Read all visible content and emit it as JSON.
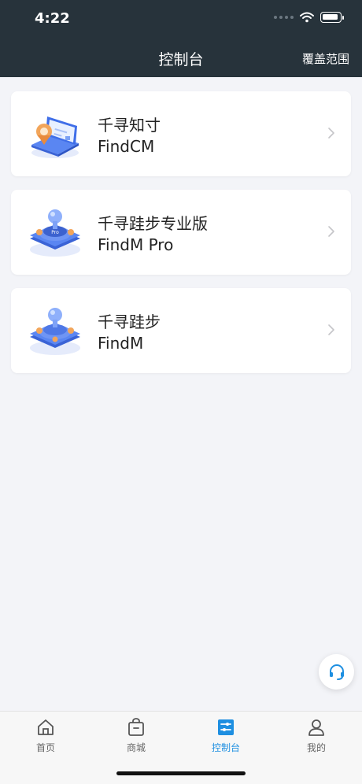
{
  "status_bar": {
    "time": "4:22"
  },
  "nav": {
    "title": "控制台",
    "right_action": "覆盖范围"
  },
  "products": [
    {
      "name_cn": "千寻知寸",
      "name_en": "FindCM",
      "icon": "laptop-icon"
    },
    {
      "name_cn": "千寻跬步专业版",
      "name_en": "FindM Pro",
      "icon": "pro-device-icon"
    },
    {
      "name_cn": "千寻跬步",
      "name_en": "FindM",
      "icon": "device-icon"
    }
  ],
  "pro_badge": "Pro",
  "tabs": [
    {
      "label": "首页",
      "icon": "home-icon",
      "active": false
    },
    {
      "label": "商城",
      "icon": "shopping-bag-icon",
      "active": false
    },
    {
      "label": "控制台",
      "icon": "console-icon",
      "active": true
    },
    {
      "label": "我的",
      "icon": "person-icon",
      "active": false
    }
  ],
  "colors": {
    "header_bg": "#27333b",
    "page_bg": "#f3f4f8",
    "accent": "#1e8fe1"
  }
}
